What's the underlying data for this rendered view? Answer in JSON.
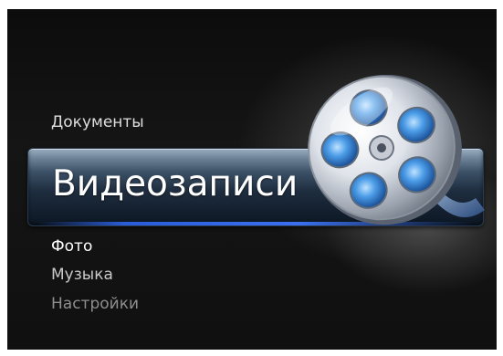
{
  "menu": {
    "items": [
      {
        "label": "Документы",
        "state": "dim"
      },
      {
        "label": "Видеозаписи",
        "state": "selected"
      },
      {
        "label": "Фото",
        "state": "normal"
      },
      {
        "label": "Музыка",
        "state": "dim"
      },
      {
        "label": "Настройки",
        "state": "dimmer"
      }
    ],
    "selected_icon": "film-reel-icon"
  },
  "colors": {
    "background": "#111111",
    "selection_bar": "#1e2d3f",
    "selection_glow": "#3a70f0",
    "reel_blue": "#3f8fe0"
  }
}
